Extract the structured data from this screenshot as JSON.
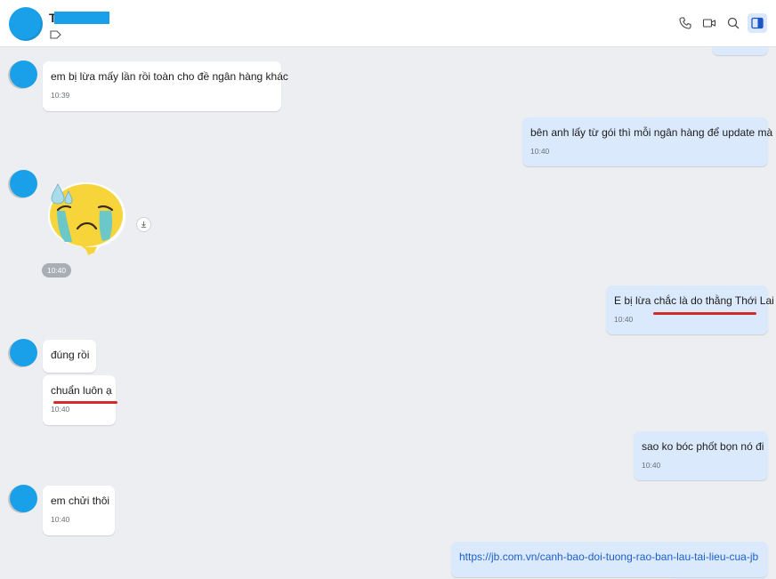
{
  "header": {
    "name_initial": "T",
    "icons": [
      "phone-icon",
      "video-call-icon",
      "search-icon",
      "sidebar-toggle-icon"
    ],
    "redaction_color": "#1aa0e8"
  },
  "messages": [
    {
      "side": "them",
      "text": "em bị lừa mấy lần rồi toàn cho đề ngân hàng khác",
      "time": "10:39"
    },
    {
      "side": "me",
      "text": "bên anh lấy từ gói thì mỗi ngân hàng để update mà",
      "time": "10:40"
    },
    {
      "side": "them",
      "type": "sticker",
      "sticker_icon": "crying-sweat-emoji-sticker",
      "time": "10:40"
    },
    {
      "side": "me",
      "text": "E bị lừa chắc là do thằng Thới Lai",
      "time": "10:40"
    },
    {
      "side": "them",
      "text": "đúng rồi"
    },
    {
      "side": "them",
      "text": "chuẩn luôn ạ",
      "time": "10:40"
    },
    {
      "side": "me",
      "text": "sao ko bóc phốt bọn nó đi",
      "time": "10:40"
    },
    {
      "side": "them",
      "text": "em chửi thôi",
      "time": "10:40"
    },
    {
      "side": "me",
      "text": "https://jb.com.vn/canh-bao-doi-tuong-rao-ban-lau-tai-lieu-cua-jb",
      "is_link": true
    }
  ],
  "colors": {
    "my_bubble": "#dbe9fc",
    "their_bubble": "#ffffff",
    "background": "#eceef2",
    "avatar": "#1aa0e8",
    "annotation_underline": "#d32a2a",
    "link": "#1d5fc9"
  }
}
